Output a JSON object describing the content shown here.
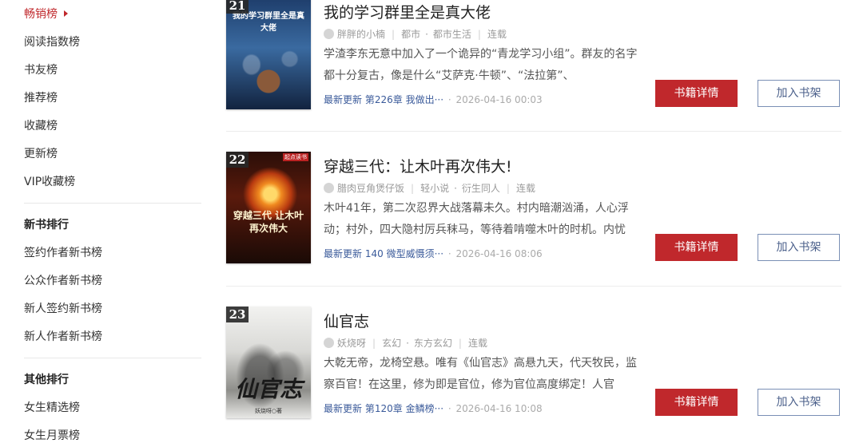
{
  "sidebar": {
    "rank_items": [
      {
        "label": "畅销榜"
      },
      {
        "label": "阅读指数榜"
      },
      {
        "label": "书友榜"
      },
      {
        "label": "推荐榜"
      },
      {
        "label": "收藏榜"
      },
      {
        "label": "更新榜"
      },
      {
        "label": "VIP收藏榜"
      }
    ],
    "new_book_heading": "新书排行",
    "new_book_items": [
      {
        "label": "签约作者新书榜"
      },
      {
        "label": "公众作者新书榜"
      },
      {
        "label": "新人签约新书榜"
      },
      {
        "label": "新人作者新书榜"
      }
    ],
    "other_heading": "其他排行",
    "other_items": [
      {
        "label": "女生精选榜"
      },
      {
        "label": "女生月票榜"
      }
    ]
  },
  "books": [
    {
      "rank": "21",
      "title": "我的学习群里全是真大佬",
      "author": "胖胖的小楠",
      "category": "都市",
      "subcategory": "都市生活",
      "status": "连载",
      "description": "学渣李东无意中加入了一个诡异的“青龙学习小组”。群友的名字都十分复古，像是什么“艾萨克·牛顿”、“法拉第”、",
      "latest_label": "最新更新",
      "latest_chapter": "第226章  我做出···",
      "latest_time": "2026-04-16 00:03",
      "cover_text": "我的学习群里全是真大佬",
      "detail_button": "书籍详情",
      "shelf_button": "加入书架"
    },
    {
      "rank": "22",
      "title": "穿越三代：让木叶再次伟大!",
      "author": "腊肉豆角煲仔饭",
      "category": "轻小说",
      "subcategory": "衍生同人",
      "status": "连载",
      "description": "木叶41年，第二次忍界大战落幕未久。村内暗潮汹涌，人心浮动；村外，四大隐村厉兵秣马，等待着啃噬木叶的时机。内忧",
      "latest_label": "最新更新",
      "latest_chapter": "140  微型威慑须···",
      "latest_time": "2026-04-16 08:06",
      "cover_text": "穿越三代 让木叶 再次伟大",
      "cover_tag": "起点读书",
      "detail_button": "书籍详情",
      "shelf_button": "加入书架"
    },
    {
      "rank": "23",
      "title": "仙官志",
      "author": "妖烧呀",
      "category": "玄幻",
      "subcategory": "东方玄幻",
      "status": "连载",
      "description": "大乾无帝，龙椅空悬。唯有《仙官志》高悬九天，代天牧民，监察百官！在这里，修为即是官位，修为官位高度绑定！人官",
      "latest_label": "最新更新",
      "latest_chapter": "第120章  金鳞榜···",
      "latest_time": "2026-04-16 10:08",
      "cover_text": "仙官志",
      "cover_sub": "妖烧呀○著",
      "detail_button": "书籍详情",
      "shelf_button": "加入书架"
    }
  ],
  "colors": {
    "accent": "#c0282c",
    "link": "#3a5a9a",
    "shelf_border": "#7a8fb5"
  }
}
